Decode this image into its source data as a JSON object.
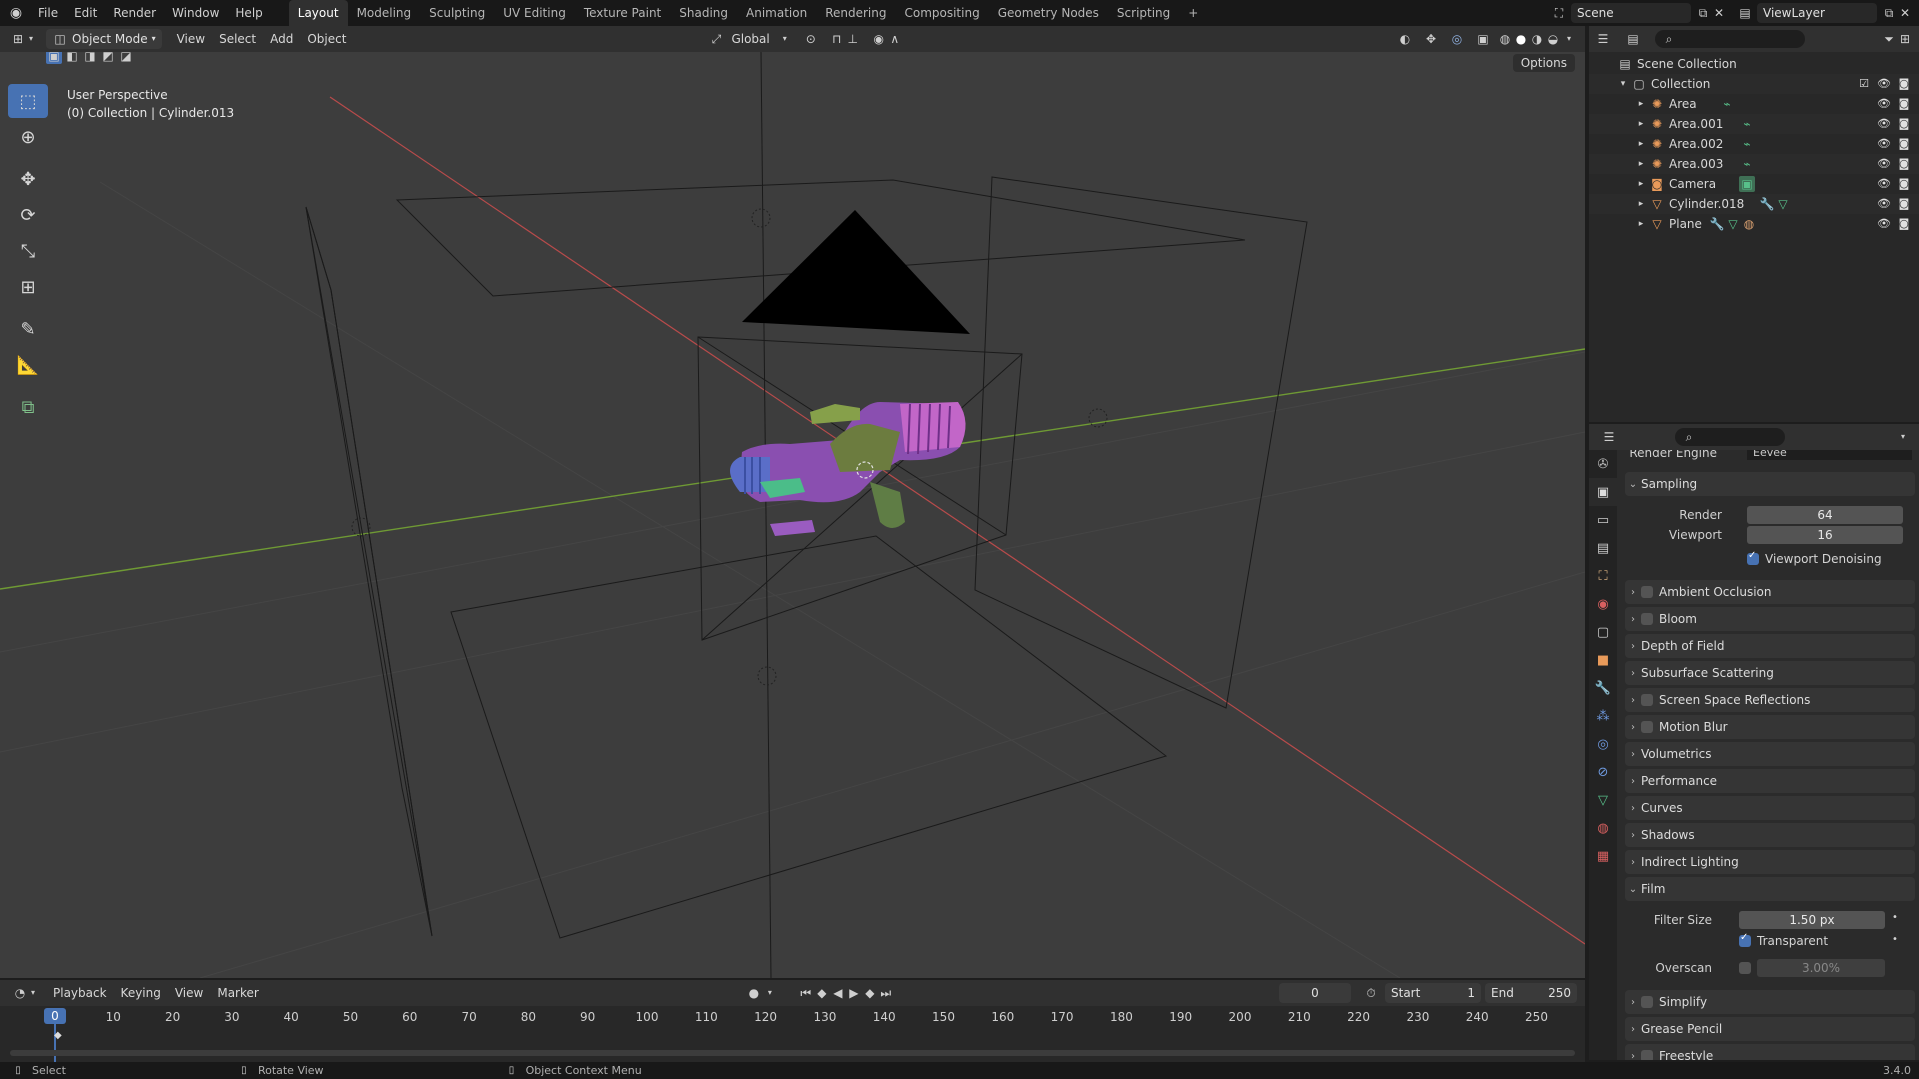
{
  "topbar": {
    "menus": [
      "File",
      "Edit",
      "Render",
      "Window",
      "Help"
    ],
    "workspaces": [
      "Layout",
      "Modeling",
      "Sculpting",
      "UV Editing",
      "Texture Paint",
      "Shading",
      "Animation",
      "Rendering",
      "Compositing",
      "Geometry Nodes",
      "Scripting"
    ],
    "active_workspace": "Layout",
    "add_tab": "+",
    "scene": "Scene",
    "view_layer": "ViewLayer"
  },
  "viewport_header": {
    "mode": "Object Mode",
    "menus": [
      "View",
      "Select",
      "Add",
      "Object"
    ],
    "transform": "Global",
    "options": "Options"
  },
  "viewport": {
    "perspective": "User Perspective",
    "context": "(0) Collection | Cylinder.013"
  },
  "outliner": {
    "root": "Scene Collection",
    "collection": "Collection",
    "items": [
      {
        "name": "Area"
      },
      {
        "name": "Area.001"
      },
      {
        "name": "Area.002"
      },
      {
        "name": "Area.003"
      },
      {
        "name": "Camera"
      },
      {
        "name": "Cylinder.018"
      },
      {
        "name": "Plane"
      }
    ]
  },
  "properties": {
    "render_engine_label": "Render Engine",
    "render_engine": "Eevee",
    "sampling": {
      "title": "Sampling",
      "render_label": "Render",
      "render": "64",
      "viewport_label": "Viewport",
      "viewport": "16",
      "denoise": "Viewport Denoising"
    },
    "panels": [
      "Ambient Occlusion",
      "Bloom",
      "Depth of Field",
      "Subsurface Scattering",
      "Screen Space Reflections",
      "Motion Blur",
      "Volumetrics",
      "Performance",
      "Curves",
      "Shadows",
      "Indirect Lighting"
    ],
    "film": {
      "title": "Film",
      "filter_label": "Filter Size",
      "filter": "1.50 px",
      "transparent": "Transparent",
      "overscan_label": "Overscan",
      "overscan": "3.00%"
    },
    "after_panels": [
      "Simplify",
      "Grease Pencil",
      "Freestyle"
    ]
  },
  "timeline": {
    "menus": [
      "Playback",
      "Keying",
      "View",
      "Marker"
    ],
    "current": "0",
    "start_label": "Start",
    "start": "1",
    "end_label": "End",
    "end": "250",
    "ticks": [
      "0",
      "10",
      "20",
      "30",
      "40",
      "50",
      "60",
      "70",
      "80",
      "90",
      "100",
      "110",
      "120",
      "130",
      "140",
      "150",
      "160",
      "170",
      "180",
      "190",
      "200",
      "210",
      "220",
      "230",
      "240",
      "250"
    ]
  },
  "statusbar": {
    "select": "Select",
    "rotate": "Rotate View",
    "context": "Object Context Menu",
    "version": "3.4.0"
  },
  "colors": {
    "accent": "#4772b3",
    "x_axis": "#b84b4b",
    "y_axis": "#6f9a34"
  }
}
